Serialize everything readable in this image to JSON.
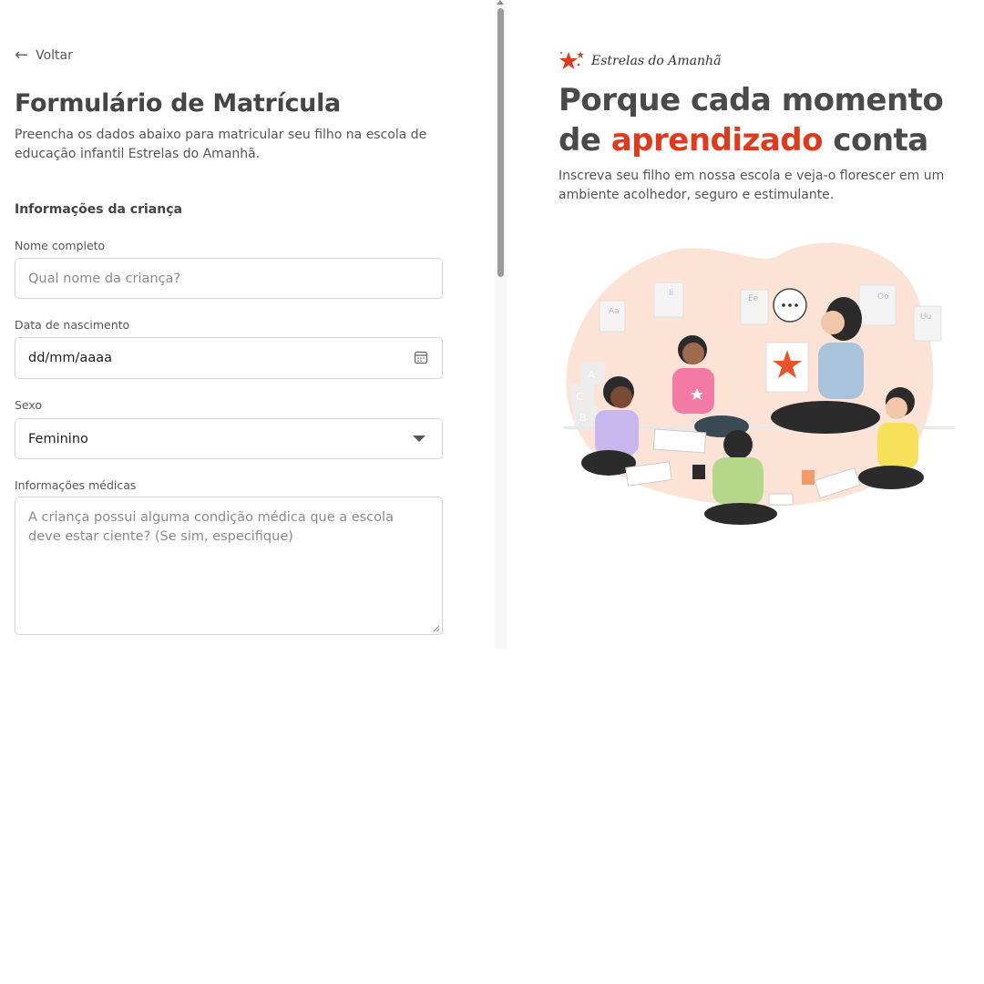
{
  "nav": {
    "back_label": "Voltar"
  },
  "form": {
    "title": "Formulário de Matrícula",
    "subtitle": "Preencha os dados abaixo para matricular seu filho na escola de educação infantil Estrelas do Amanhã.",
    "section_title": "Informações da criança",
    "fields": {
      "name": {
        "label": "Nome completo",
        "placeholder": "Qual nome da criança?"
      },
      "birthdate": {
        "label": "Data de nascimento",
        "value": "dd/mm/aaaa"
      },
      "sex": {
        "label": "Sexo",
        "value": "Feminino"
      },
      "medical": {
        "label": "Informações médicas",
        "placeholder": "A criança possui alguma condição médica que a escola deve estar ciente? (Se sim, especifique)"
      }
    }
  },
  "hero": {
    "brand_name": "Estrelas do Amanhã",
    "title_part1": "Porque cada momento de ",
    "title_accent": "aprendizado",
    "title_part2": " conta",
    "subtitle": "Inscreva seu filho em nossa escola e veja-o florescer em um ambiente acolhedor, seguro e estimulante."
  },
  "colors": {
    "accent": "#e0391c",
    "text_dark": "#454545",
    "border": "#d4d4d4",
    "blob": "#fde3d6"
  },
  "icons": [
    "back-arrow-icon",
    "calendar-icon",
    "caret-down-icon",
    "resize-handle-icon",
    "stars-logo-icon"
  ]
}
